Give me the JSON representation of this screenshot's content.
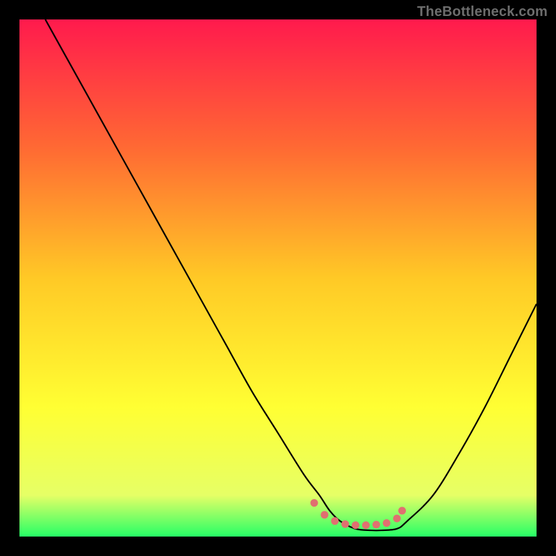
{
  "watermark": "TheBottleneck.com",
  "chart_data": {
    "type": "line",
    "title": "",
    "xlabel": "",
    "ylabel": "",
    "xlim": [
      0,
      100
    ],
    "ylim": [
      0,
      100
    ],
    "grid": false,
    "legend": false,
    "background_gradient": {
      "stops": [
        {
          "offset": 0.0,
          "color": "#ff1a4d"
        },
        {
          "offset": 0.25,
          "color": "#ff6a33"
        },
        {
          "offset": 0.5,
          "color": "#ffc926"
        },
        {
          "offset": 0.75,
          "color": "#ffff33"
        },
        {
          "offset": 0.92,
          "color": "#e6ff66"
        },
        {
          "offset": 1.0,
          "color": "#26ff66"
        }
      ]
    },
    "series": [
      {
        "name": "curve",
        "color": "#000000",
        "x": [
          5,
          10,
          15,
          20,
          25,
          30,
          35,
          40,
          45,
          50,
          55,
          58,
          60,
          62,
          65,
          68,
          70,
          73,
          75,
          80,
          85,
          90,
          95,
          100
        ],
        "values": [
          100,
          91,
          82,
          73,
          64,
          55,
          46,
          37,
          28,
          20,
          12,
          8,
          5,
          3,
          1.5,
          1.2,
          1.2,
          1.5,
          3,
          8,
          16,
          25,
          35,
          45
        ]
      },
      {
        "name": "highlight-dots",
        "color": "#e07070",
        "type": "scatter",
        "x": [
          57,
          59,
          61,
          63,
          65,
          67,
          69,
          71,
          73,
          74
        ],
        "values": [
          6.5,
          4.2,
          3.0,
          2.4,
          2.2,
          2.2,
          2.3,
          2.6,
          3.5,
          5.0
        ]
      }
    ]
  }
}
